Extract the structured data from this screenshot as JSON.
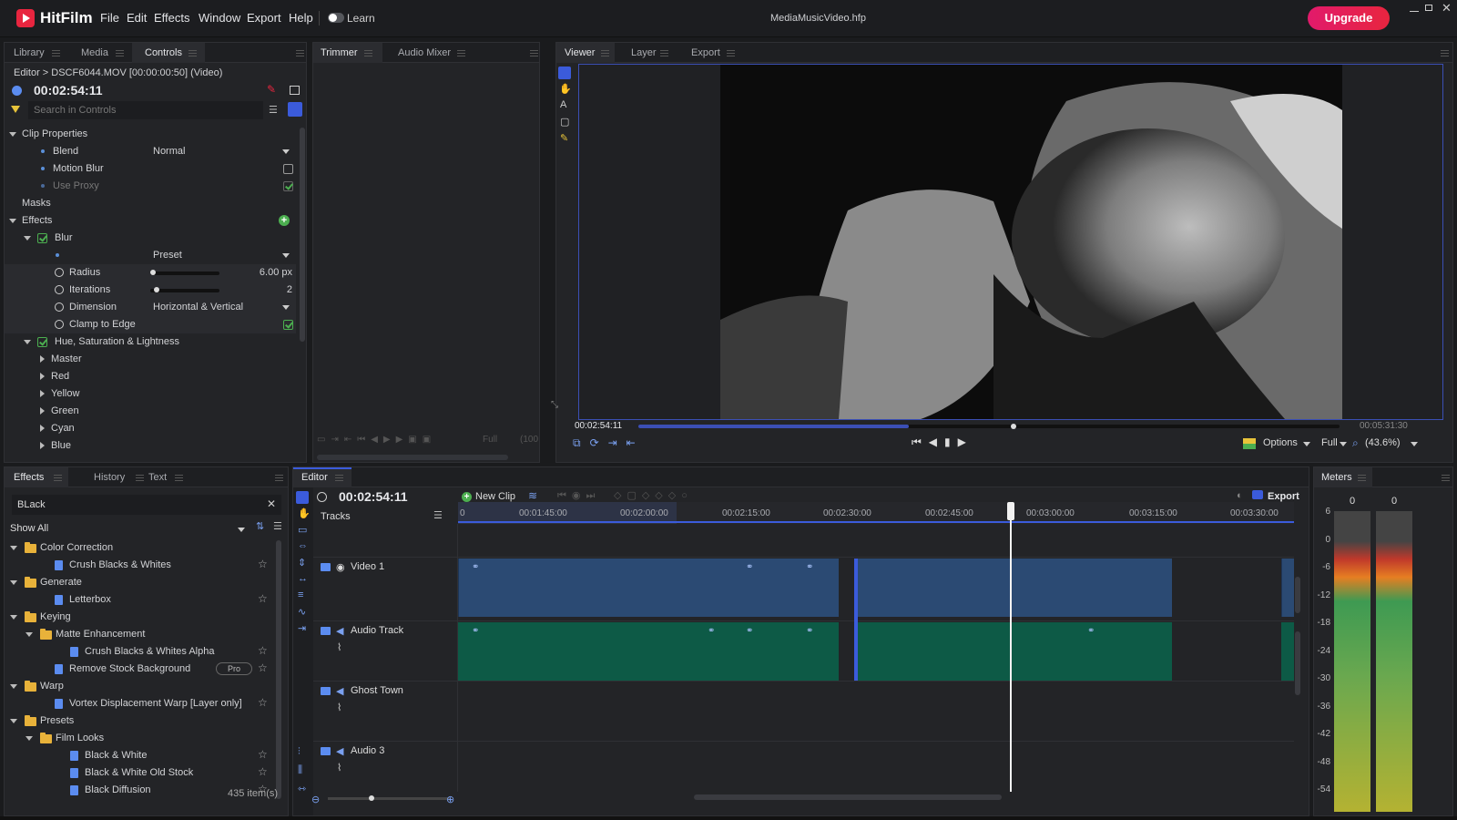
{
  "app": {
    "name": "HitFilm",
    "menus": [
      "File",
      "Edit",
      "Effects",
      "Window",
      "Export",
      "Help"
    ],
    "learn_label": "Learn",
    "project_file": "MediaMusicVideo.hfp",
    "upgrade_label": "Upgrade"
  },
  "colors": {
    "accent": "#e8253f",
    "upgrade_gradient": [
      "#e11a6b",
      "#e8253f"
    ],
    "video_clip": "#2b4a73",
    "audio_clip": "#0d5a46",
    "selection": "#3b5bdb"
  },
  "controls_panel": {
    "tabs": [
      "Library",
      "Media",
      "Controls"
    ],
    "breadcrumb": "Editor > DSCF6044.MOV [00:00:00:50] (Video)",
    "timecode": "00:02:54:11",
    "search_placeholder": "Search in Controls",
    "clip_properties": "Clip Properties",
    "blend_label": "Blend",
    "blend_value": "Normal",
    "motion_blur_label": "Motion Blur",
    "use_proxy_label": "Use Proxy",
    "masks_label": "Masks",
    "effects_label": "Effects",
    "blur_label": "Blur",
    "preset_value": "Preset",
    "radius_label": "Radius",
    "radius_value": "6.00 px",
    "iterations_label": "Iterations",
    "iterations_value": "2",
    "dimension_label": "Dimension",
    "dimension_value": "Horizontal & Vertical",
    "clamp_label": "Clamp to Edge",
    "hsl_label": "Hue, Saturation & Lightness",
    "hsl_items": [
      "Master",
      "Red",
      "Yellow",
      "Green",
      "Cyan",
      "Blue"
    ]
  },
  "trimmer_panel": {
    "tabs": [
      "Trimmer",
      "Audio Mixer"
    ],
    "quality": "Full",
    "zoom": "(100"
  },
  "viewer_panel": {
    "tabs": [
      "Viewer",
      "Layer",
      "Export"
    ],
    "current_time": "00:02:54:11",
    "duration": "00:05:31:30",
    "options_label": "Options",
    "quality": "Full",
    "zoom": "(43.6%)"
  },
  "effects_panel": {
    "tabs": [
      "Effects",
      "History",
      "Text"
    ],
    "search_value": "BLack",
    "filter_value": "Show All",
    "count": "435 item(s)",
    "tree": [
      {
        "type": "folder",
        "label": "Color Correction",
        "level": 0
      },
      {
        "type": "effect",
        "label": "Crush Blacks & Whites",
        "level": 1
      },
      {
        "type": "folder",
        "label": "Generate",
        "level": 0
      },
      {
        "type": "effect",
        "label": "Letterbox",
        "level": 1
      },
      {
        "type": "folder",
        "label": "Keying",
        "level": 0
      },
      {
        "type": "folder",
        "label": "Matte Enhancement",
        "level": 1
      },
      {
        "type": "effect",
        "label": "Crush Blacks & Whites Alpha",
        "level": 2
      },
      {
        "type": "effect",
        "label": "Remove Stock Background",
        "level": 1,
        "badge": "Pro"
      },
      {
        "type": "folder",
        "label": "Warp",
        "level": 0
      },
      {
        "type": "effect",
        "label": "Vortex Displacement Warp [Layer only]",
        "level": 1
      },
      {
        "type": "folder",
        "label": "Presets",
        "level": 0
      },
      {
        "type": "folder",
        "label": "Film Looks",
        "level": 1
      },
      {
        "type": "effect",
        "label": "Black & White",
        "level": 2
      },
      {
        "type": "effect",
        "label": "Black & White Old Stock",
        "level": 2
      },
      {
        "type": "effect",
        "label": "Black Diffusion",
        "level": 2
      }
    ]
  },
  "editor_panel": {
    "tab": "Editor",
    "timecode": "00:02:54:11",
    "new_clip_label": "New Clip",
    "export_label": "Export",
    "tracks_label": "Tracks",
    "ruler": [
      "0",
      "00:01:45:00",
      "00:02:00:00",
      "00:02:15:00",
      "00:02:30:00",
      "00:02:45:00",
      "00:03:00:00",
      "00:03:15:00",
      "00:03:30:00"
    ],
    "tracks": [
      "Video 1",
      "Audio Track",
      "Ghost Town",
      "Audio 3"
    ]
  },
  "meters_panel": {
    "tab": "Meters",
    "peak_left": "0",
    "peak_right": "0",
    "scale": [
      "6",
      "0",
      "-6",
      "-12",
      "-18",
      "-24",
      "-30",
      "-36",
      "-42",
      "-48",
      "-54"
    ]
  }
}
